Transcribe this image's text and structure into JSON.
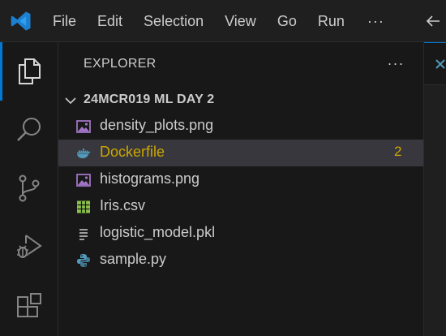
{
  "titlebar": {
    "menu": [
      "File",
      "Edit",
      "Selection",
      "View",
      "Go",
      "Run"
    ],
    "more_label": "···"
  },
  "activity_bar": {
    "items": [
      {
        "icon": "explorer-icon",
        "active": true
      },
      {
        "icon": "search-icon",
        "active": false
      },
      {
        "icon": "source-control-icon",
        "active": false
      },
      {
        "icon": "run-debug-icon",
        "active": false
      },
      {
        "icon": "extensions-icon",
        "active": false
      }
    ]
  },
  "sidebar": {
    "title": "EXPLORER",
    "more_label": "···",
    "folder": {
      "name": "24MCR019 ML DAY 2",
      "expanded": true
    },
    "files": [
      {
        "name": "density_plots.png",
        "icon": "image-file-icon",
        "selected": false,
        "badge": ""
      },
      {
        "name": "Dockerfile",
        "icon": "docker-file-icon",
        "selected": true,
        "badge": "2"
      },
      {
        "name": "histograms.png",
        "icon": "image-file-icon",
        "selected": false,
        "badge": ""
      },
      {
        "name": "Iris.csv",
        "icon": "csv-file-icon",
        "selected": false,
        "badge": ""
      },
      {
        "name": "logistic_model.pkl",
        "icon": "text-file-icon",
        "selected": false,
        "badge": ""
      },
      {
        "name": "sample.py",
        "icon": "python-file-icon",
        "selected": false,
        "badge": ""
      }
    ]
  },
  "colors": {
    "accent": "#0078d4",
    "warning": "#cca700",
    "image_icon": "#a074c4",
    "docker_icon": "#519aba",
    "csv_icon": "#8dc149",
    "python_icon": "#519aba"
  }
}
